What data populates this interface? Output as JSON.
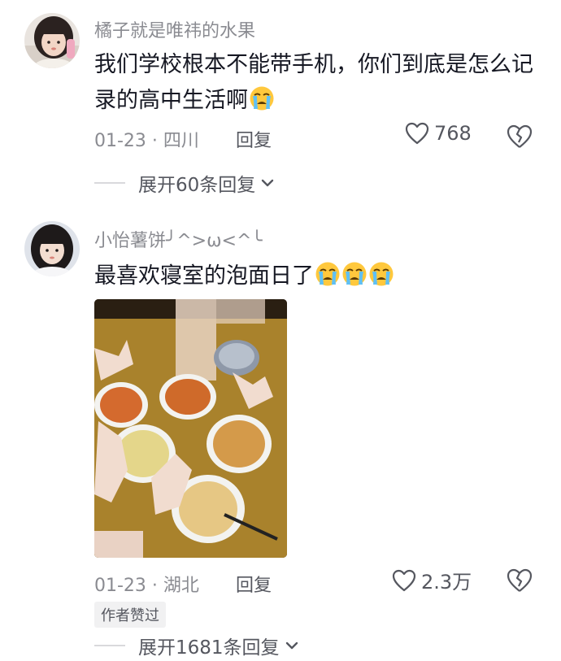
{
  "comments": [
    {
      "username": "橘子就是唯祎的水果",
      "text": "我们学校根本不能带手机，你们到底是怎么记录的高中生活啊",
      "emoji_count": 1,
      "emoji_icon": "crying-face-icon",
      "date_location": "01-23 · 四川",
      "reply_label": "回复",
      "like_count": "768",
      "expand_label": "展开60条回复"
    },
    {
      "username": "小怡薯饼╯^>ω<^╰",
      "text": "最喜欢寝室的泡面日了",
      "emoji_count": 3,
      "emoji_icon": "crying-face-icon",
      "date_location": "01-23 · 湖北",
      "reply_label": "回复",
      "like_count": "2.3万",
      "author_badge": "作者赞过",
      "expand_label": "展开1681条回复"
    }
  ],
  "colors": {
    "primary_text": "#161823",
    "secondary_text": "#8a8b91",
    "action_text": "#55575f",
    "badge_bg": "#f1f1f2",
    "emoji_yellow": "#ffc83d"
  }
}
